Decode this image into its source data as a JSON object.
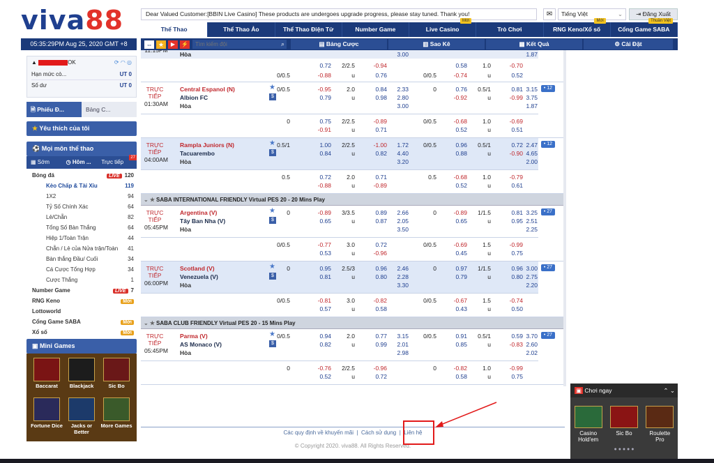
{
  "logo": {
    "part1": "viva",
    "part2": "88"
  },
  "clock": "05:35:29PM Aug 25, 2020 GMT +8",
  "notice": "Dear Valued Customer:[BBIN Live Casino] These products are undergoes upgrade progress, please stay tuned. Thank you!",
  "language": "Tiếng Việt",
  "logout": "Đăng Xuất",
  "topnav": [
    {
      "label": "Thể Thao",
      "badge": ""
    },
    {
      "label": "Thể Thao Ảo",
      "badge": ""
    },
    {
      "label": "Thể Thao Điện Tử",
      "badge": ""
    },
    {
      "label": "Number Game",
      "badge": ""
    },
    {
      "label": "Live Casino",
      "badge": "Mới"
    },
    {
      "label": "Trò Chơi",
      "badge": ""
    },
    {
      "label": "RNG Keno/Xổ số",
      "badge": "Mới"
    },
    {
      "label": "Cổng Game SABA",
      "badge": "Thuần Việt"
    }
  ],
  "subnav": {
    "search_placeholder": "Tìm kiếm đội",
    "bet_list": "Bảng Cược",
    "statement": "Sao Kê",
    "results": "Kết Quả",
    "settings": "Cài Đặt"
  },
  "account": {
    "user": "OK",
    "credit_label": "Hạn mức cò...",
    "credit_value": "UT 0",
    "balance_label": "Số dư",
    "balance_value": "UT 0"
  },
  "slip": {
    "tab1": "Phiếu Đ...",
    "tab2": "Bảng C..."
  },
  "favorites": "Yêu thích của tôi",
  "all_sports": "Mọi môn thể thao",
  "time_tabs": {
    "early": "Sớm",
    "today": "Hôm ...",
    "live": "Trực tiếp",
    "live_count": "27"
  },
  "sports": [
    {
      "label": "Bóng đá",
      "count": "120",
      "live": "LIVE",
      "main": true
    },
    {
      "label": "Kèo Chấp & Tài Xỉu",
      "count": "119",
      "sel": true
    },
    {
      "label": "1X2",
      "count": "94"
    },
    {
      "label": "Tỷ Số Chính Xác",
      "count": "64"
    },
    {
      "label": "Lẻ/Chẵn",
      "count": "82"
    },
    {
      "label": "Tổng Số Bàn Thắng",
      "count": "64"
    },
    {
      "label": "Hiệp 1/Toàn Trận",
      "count": "44"
    },
    {
      "label": "Chẵn / Lẻ của Nửa trận/Toàn",
      "count": "41"
    },
    {
      "label": "Bàn thắng Đầu/ Cuối",
      "count": "34"
    },
    {
      "label": "Cá Cược Tổng Hợp",
      "count": "34"
    },
    {
      "label": "Cược Thắng",
      "count": "1"
    },
    {
      "label": "Number Game",
      "count": "7",
      "live": "LIVE",
      "main": true
    },
    {
      "label": "RNG Keno",
      "count": "",
      "moi": "Mới",
      "main": true
    },
    {
      "label": "Lottoworld",
      "count": "",
      "main": true
    },
    {
      "label": "Cổng Game SABA",
      "count": "",
      "moi": "Mới",
      "main": true
    },
    {
      "label": "Xổ số",
      "count": "",
      "moi": "Mới",
      "main": true
    }
  ],
  "mini_games_title": "Mini Games",
  "mini_games": [
    "Baccarat",
    "Blackjack",
    "Sic Bo",
    "Fortune Dice",
    "Jacks or Better",
    "More Games"
  ],
  "leagues": [
    "SABA INTERNATIONAL FRIENDLY Virtual PES 20 - 20 Mins Play",
    "SABA CLUB FRIENDLY Virtual PES 20 - 15 Mins Play"
  ],
  "rows": [
    {
      "id": "r0",
      "top": 0,
      "time": [
        "11:15PM"
      ],
      "home": "Hòa",
      "away": "",
      "draw": "",
      "cells": [
        [
          "",
          "",
          "",
          "",
          "3.00",
          "",
          "",
          "",
          "",
          "",
          "1.87"
        ],
        [
          "0.72",
          "2/2.5",
          "-0.94",
          "",
          "0.58",
          "1.0",
          "-0.70",
          ""
        ],
        [
          "0/0.5",
          "-0.88",
          "u",
          "0.76",
          "",
          "0/0.5",
          "-0.74",
          "u",
          "0.52"
        ]
      ]
    },
    {
      "id": "r1",
      "time": [
        "TRỰC",
        "TIẾP",
        "01:30AM"
      ],
      "home": "Central Espanol (N)",
      "away": "Albion FC",
      "draw": "Hòa",
      "more": "• 12"
    }
  ],
  "match_rows": [
    {
      "time1": "TRỰC",
      "time2": "TIẾP",
      "time3": "01:30AM",
      "home": "Central Espanol (N)",
      "away": "Albion FC",
      "draw": "Hòa",
      "hc": "0/0.5",
      "h1": "-0.95",
      "h2": "0.79",
      "ou": "2.0",
      "o1": "0.84",
      "o2": "0.98",
      "x1": "2.33",
      "x2": "2.80",
      "x3": "3.00",
      "fhc": "0",
      "fh1": "0.76",
      "fh2": "-0.92",
      "fou": "0.5/1",
      "fo1": "0.81",
      "fo2": "-0.99",
      "fx1": "3.15",
      "fx2": "3.75",
      "fx3": "1.87",
      "more": "• 12",
      "alt": {
        "hc": "0",
        "h1": "0.75",
        "h2": "-0.91",
        "ou": "2/2.5",
        "o1": "-0.89",
        "o2": "0.71",
        "fhc": "0/0.5",
        "fh1": "-0.68",
        "fh2": "0.52",
        "fou": "1.0",
        "fo1": "-0.69",
        "fo2": "0.51"
      }
    },
    {
      "time1": "TRỰC",
      "time2": "TIẾP",
      "time3": "04:00AM",
      "home": "Rampla Juniors (N)",
      "away": "Tacuarembo",
      "draw": "Hòa",
      "hc": "0.5/1",
      "h1": "1.00",
      "h2": "0.84",
      "ou": "2/2.5",
      "o1": "-1.00",
      "o2": "0.82",
      "x1": "1.72",
      "x2": "4.40",
      "x3": "3.20",
      "fhc": "0/0.5",
      "fh1": "0.96",
      "fh2": "0.88",
      "fou": "0.5/1",
      "fo1": "0.72",
      "fo2": "-0.90",
      "fx1": "2.47",
      "fx2": "4.65",
      "fx3": "2.00",
      "more": "• 12",
      "alt": {
        "hc": "0.5",
        "h1": "0.72",
        "h2": "-0.88",
        "ou": "2.0",
        "o1": "0.71",
        "o2": "-0.89",
        "fhc": "0.5",
        "fh1": "-0.68",
        "fh2": "0.52",
        "fou": "1.0",
        "fo1": "-0.79",
        "fo2": "0.61"
      }
    },
    {
      "time1": "TRỰC",
      "time2": "TIẾP",
      "time3": "05:45PM",
      "home": "Argentina (V)",
      "away": "Tây Ban Nha (V)",
      "draw": "Hòa",
      "hc": "0",
      "h1": "-0.89",
      "h2": "0.65",
      "ou": "3/3.5",
      "o1": "0.89",
      "o2": "0.87",
      "x1": "2.66",
      "x2": "2.05",
      "x3": "3.50",
      "fhc": "0",
      "fh1": "-0.89",
      "fh2": "0.65",
      "fou": "1/1.5",
      "fo1": "0.81",
      "fo2": "0.95",
      "fx1": "3.25",
      "fx2": "2.51",
      "fx3": "2.25",
      "more": "• 27",
      "alt": {
        "hc": "0/0.5",
        "h1": "-0.77",
        "h2": "0.53",
        "ou": "3.0",
        "o1": "0.72",
        "o2": "-0.96",
        "fhc": "0/0.5",
        "fh1": "-0.69",
        "fh2": "0.45",
        "fou": "1.5",
        "fo1": "-0.99",
        "fo2": "0.75"
      }
    },
    {
      "time1": "TRỰC",
      "time2": "TIẾP",
      "time3": "06:00PM",
      "home": "Scotland (V)",
      "away": "Venezuela (V)",
      "draw": "Hòa",
      "hc": "0",
      "h1": "0.95",
      "h2": "0.81",
      "ou": "2.5/3",
      "o1": "0.96",
      "o2": "0.80",
      "x1": "2.46",
      "x2": "2.28",
      "x3": "3.30",
      "fhc": "0",
      "fh1": "0.97",
      "fh2": "0.79",
      "fou": "1/1.5",
      "fo1": "0.96",
      "fo2": "0.80",
      "fx1": "3.00",
      "fx2": "2.75",
      "fx3": "2.20",
      "more": "• 27",
      "alt": {
        "hc": "0/0.5",
        "h1": "-0.81",
        "h2": "0.57",
        "ou": "3.0",
        "o1": "-0.82",
        "o2": "0.58",
        "fhc": "0/0.5",
        "fh1": "-0.67",
        "fh2": "0.43",
        "fou": "1.5",
        "fo1": "-0.74",
        "fo2": "0.50"
      }
    },
    {
      "time1": "TRỰC",
      "time2": "TIẾP",
      "time3": "05:45PM",
      "home": "Parma (V)",
      "away": "AS Monaco (V)",
      "draw": "Hòa",
      "hc": "0/0.5",
      "h1": "0.94",
      "h2": "0.82",
      "ou": "2.0",
      "o1": "0.77",
      "o2": "0.99",
      "x1": "3.15",
      "x2": "2.01",
      "x3": "2.98",
      "fhc": "0/0.5",
      "fh1": "0.91",
      "fh2": "0.85",
      "fou": "0.5/1",
      "fo1": "0.59",
      "fo2": "-0.83",
      "fx1": "3.70",
      "fx2": "2.60",
      "fx3": "2.02",
      "more": "• 27",
      "alt": {
        "hc": "0",
        "h1": "-0.76",
        "h2": "0.52",
        "ou": "2/2.5",
        "o1": "-0.96",
        "o2": "0.72",
        "fhc": "0",
        "fh1": "-0.82",
        "fh2": "0.58",
        "fou": "1.0",
        "fo1": "-0.99",
        "fo2": "0.75"
      }
    }
  ],
  "top_partial": {
    "draw": "Hòa",
    "x3": "3.00",
    "fx3": "1.87",
    "time": "11:15PM",
    "h1": "0.72",
    "ou": "2/2.5",
    "o1": "-0.94",
    "fh1": "0.58",
    "fou": "1.0",
    "fo1": "-0.70",
    "hc": "0/0.5",
    "h2": "-0.88",
    "o2": "0.76",
    "fhc": "0/0.5",
    "fh2": "-0.74",
    "fo2": "0.52"
  },
  "under": "u",
  "footer": {
    "promo_link": "Các quy định về khuyến mãi",
    "usage_link": "Cách sử dụng",
    "contact_link": "Liên hệ",
    "copyright": "© Copyright 2020. viva88. All Rights Reserved."
  },
  "promo": {
    "title": "Chơi ngay",
    "items": [
      "Casino Hold'em",
      "Sic Bo",
      "Roulette Pro"
    ]
  }
}
